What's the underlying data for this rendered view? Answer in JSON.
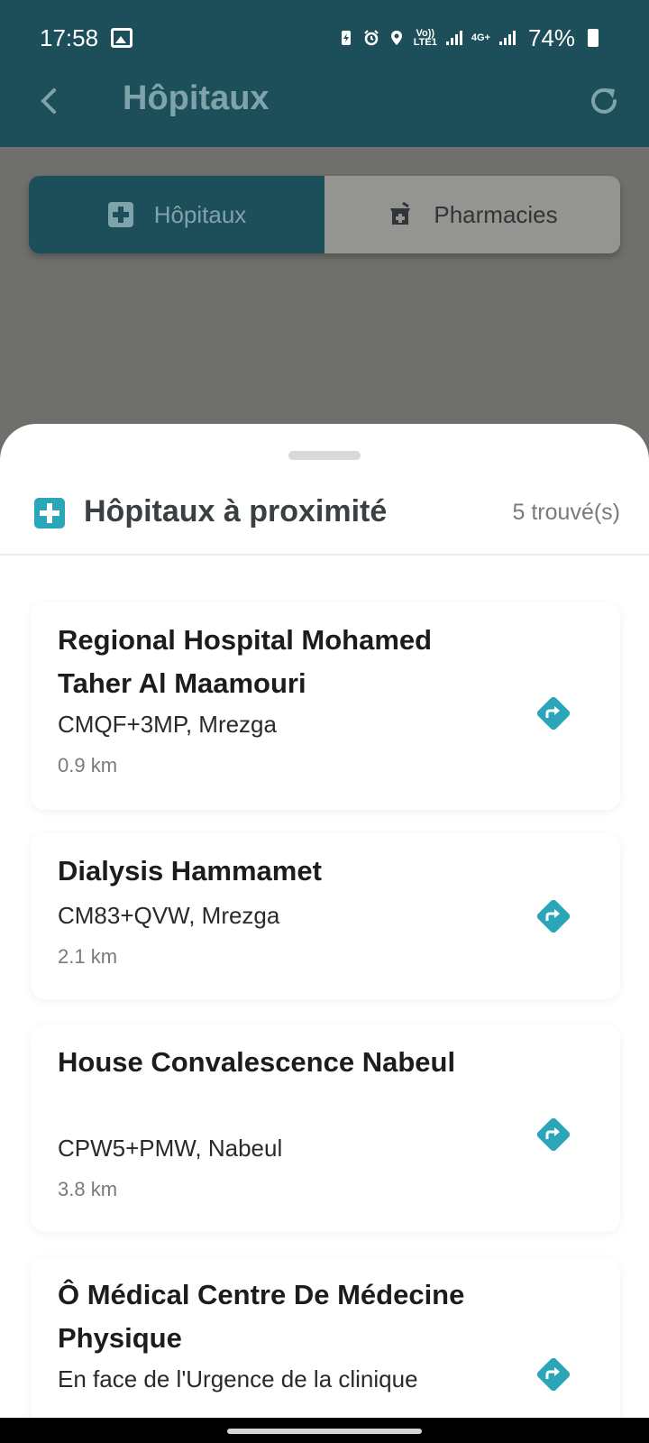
{
  "status_bar": {
    "time": "17:58",
    "lte_label_top": "Vo))",
    "lte_label_bottom": "LTE1",
    "net_label": "4G+",
    "battery_pct": "74%"
  },
  "app_bar": {
    "title": "Hôpitaux",
    "back_icon": "chevron-left-icon",
    "refresh_icon": "refresh-icon"
  },
  "tabs": [
    {
      "label": "Hôpitaux",
      "icon": "hospital-cross-icon",
      "active": true
    },
    {
      "label": "Pharmacies",
      "icon": "pharmacy-mortar-icon",
      "active": false
    }
  ],
  "sheet": {
    "title": "Hôpitaux à proximité",
    "count": "5 trouvé(s)",
    "items": [
      {
        "name": "Regional Hospital Mohamed Taher Al Maamouri",
        "address": "CMQF+3MP, Mrezga",
        "distance": "0.9 km"
      },
      {
        "name": "Dialysis Hammamet",
        "address": "CM83+QVW, Mrezga",
        "distance": "2.1 km"
      },
      {
        "name": "House Convalescence Nabeul",
        "address": "CPW5+PMW, Nabeul",
        "distance": "3.8 km"
      },
      {
        "name": "Ô Médical Centre De Médecine Physique",
        "address": "En face de l'Urgence de la clinique",
        "distance": ""
      }
    ]
  },
  "colors": {
    "primary": "#1c4f5a",
    "accent": "#2aa6b8",
    "scrim": "#6f6f6b"
  }
}
